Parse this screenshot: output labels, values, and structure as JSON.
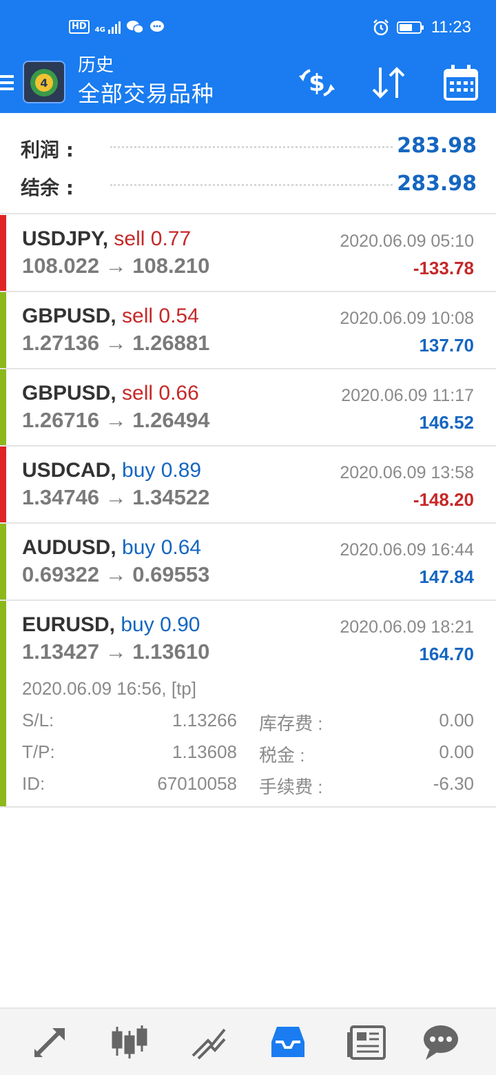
{
  "statusbar": {
    "hd": "HD",
    "network": "4G",
    "time": "11:23"
  },
  "toolbar": {
    "title": "历史",
    "subtitle": "全部交易品种"
  },
  "summary": {
    "profit_label": "利润 :",
    "profit_value": "283.98",
    "balance_label": "结余 :",
    "balance_value": "283.98"
  },
  "colors": {
    "accent": "#1a7cf0",
    "sell": "#c62828",
    "buy": "#1566c0",
    "loss_bar": "#e02424",
    "profit_bar": "#8cb81a"
  },
  "trades": [
    {
      "symbol": "USDJPY,",
      "side": "sell 0.77",
      "time": "2020.06.09 05:10",
      "prices": "108.022 → 108.210",
      "profit": "-133.78"
    },
    {
      "symbol": "GBPUSD,",
      "side": "sell 0.54",
      "time": "2020.06.09 10:08",
      "prices": "1.27136 → 1.26881",
      "profit": "137.70"
    },
    {
      "symbol": "GBPUSD,",
      "side": "sell 0.66",
      "time": "2020.06.09 11:17",
      "prices": "1.26716 → 1.26494",
      "profit": "146.52"
    },
    {
      "symbol": "USDCAD,",
      "side": "buy 0.89",
      "time": "2020.06.09 13:58",
      "prices": "1.34746 → 1.34522",
      "profit": "-148.20"
    },
    {
      "symbol": "AUDUSD,",
      "side": "buy 0.64",
      "time": "2020.06.09 16:44",
      "prices": "0.69322 → 0.69553",
      "profit": "147.84"
    },
    {
      "symbol": "EURUSD,",
      "side": "buy 0.90",
      "time": "2020.06.09 18:21",
      "prices": "1.13427 → 1.13610",
      "profit": "164.70"
    }
  ],
  "details": {
    "close_time": "2020.06.09 16:56, [tp]",
    "sl_label": "S/L:",
    "sl_value": "1.13266",
    "swap_label": "库存费 :",
    "swap_value": "0.00",
    "tp_label": "T/P:",
    "tp_value": "1.13608",
    "tax_label": "税金 :",
    "tax_value": "0.00",
    "id_label": "ID:",
    "id_value": "67010058",
    "fee_label": "手续费 :",
    "fee_value": "-6.30"
  },
  "bottom_nav": [
    {
      "icon": "quotes-icon"
    },
    {
      "icon": "chart-icon"
    },
    {
      "icon": "trade-icon"
    },
    {
      "icon": "history-icon",
      "active": true
    },
    {
      "icon": "news-icon"
    },
    {
      "icon": "chat-icon"
    }
  ]
}
